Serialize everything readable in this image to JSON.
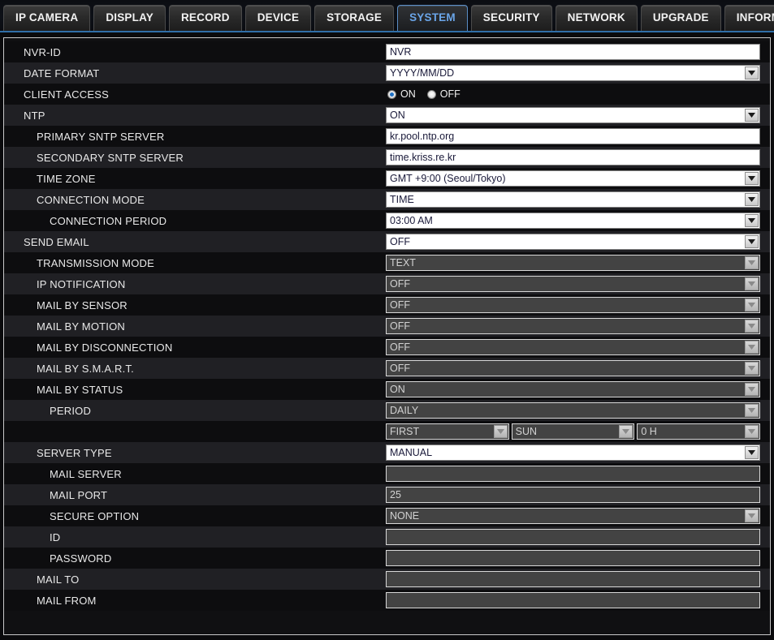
{
  "tabs": [
    {
      "label": "IP CAMERA",
      "active": false
    },
    {
      "label": "DISPLAY",
      "active": false
    },
    {
      "label": "RECORD",
      "active": false
    },
    {
      "label": "DEVICE",
      "active": false
    },
    {
      "label": "STORAGE",
      "active": false
    },
    {
      "label": "SYSTEM",
      "active": true
    },
    {
      "label": "SECURITY",
      "active": false
    },
    {
      "label": "NETWORK",
      "active": false
    },
    {
      "label": "UPGRADE",
      "active": false
    },
    {
      "label": "INFORMATION",
      "active": false
    }
  ],
  "colors": {
    "active_tab_text": "#6aa5e8",
    "tab_underline": "#2f6ea8",
    "radio_selected": "#1d6fc4",
    "input_text": "#1a1a3a",
    "disabled_text": "#d2d2d2",
    "disabled_bg": "#434343"
  },
  "radio": {
    "on_label": "ON",
    "off_label": "OFF",
    "selected": "ON"
  },
  "rows": [
    {
      "label": "NVR-ID",
      "indent": 0,
      "type": "text",
      "value": "NVR",
      "disabled": false
    },
    {
      "label": "DATE FORMAT",
      "indent": 0,
      "type": "select",
      "value": "YYYY/MM/DD",
      "disabled": false
    },
    {
      "label": "CLIENT ACCESS",
      "indent": 0,
      "type": "radio",
      "value": "ON",
      "disabled": false
    },
    {
      "label": "NTP",
      "indent": 0,
      "type": "select",
      "value": "ON",
      "disabled": false
    },
    {
      "label": "PRIMARY SNTP SERVER",
      "indent": 1,
      "type": "text",
      "value": "kr.pool.ntp.org",
      "disabled": false
    },
    {
      "label": "SECONDARY SNTP SERVER",
      "indent": 1,
      "type": "text",
      "value": "time.kriss.re.kr",
      "disabled": false
    },
    {
      "label": "TIME ZONE",
      "indent": 1,
      "type": "select",
      "value": "GMT +9:00 (Seoul/Tokyo)",
      "disabled": false
    },
    {
      "label": "CONNECTION MODE",
      "indent": 1,
      "type": "select",
      "value": "TIME",
      "disabled": false
    },
    {
      "label": "CONNECTION PERIOD",
      "indent": 2,
      "type": "select",
      "value": "03:00 AM",
      "disabled": false
    },
    {
      "label": "SEND EMAIL",
      "indent": 0,
      "type": "select",
      "value": "OFF",
      "disabled": false
    },
    {
      "label": "TRANSMISSION MODE",
      "indent": 1,
      "type": "select",
      "value": "TEXT",
      "disabled": true
    },
    {
      "label": "IP NOTIFICATION",
      "indent": 1,
      "type": "select",
      "value": "OFF",
      "disabled": true
    },
    {
      "label": "MAIL BY SENSOR",
      "indent": 1,
      "type": "select",
      "value": "OFF",
      "disabled": true
    },
    {
      "label": "MAIL BY MOTION",
      "indent": 1,
      "type": "select",
      "value": "OFF",
      "disabled": true
    },
    {
      "label": "MAIL BY DISCONNECTION",
      "indent": 1,
      "type": "select",
      "value": "OFF",
      "disabled": true
    },
    {
      "label": "MAIL BY S.M.A.R.T.",
      "indent": 1,
      "type": "select",
      "value": "OFF",
      "disabled": true
    },
    {
      "label": "MAIL BY STATUS",
      "indent": 1,
      "type": "select",
      "value": "ON",
      "disabled": true
    },
    {
      "label": "PERIOD",
      "indent": 2,
      "type": "select",
      "value": "DAILY",
      "disabled": true
    },
    {
      "label": "",
      "indent": 2,
      "type": "triple",
      "values": [
        "FIRST",
        "SUN",
        "0 H"
      ],
      "disabled": true
    },
    {
      "label": "SERVER TYPE",
      "indent": 1,
      "type": "select",
      "value": "MANUAL",
      "disabled": false
    },
    {
      "label": "MAIL SERVER",
      "indent": 2,
      "type": "text",
      "value": "",
      "disabled": true
    },
    {
      "label": "MAIL PORT",
      "indent": 2,
      "type": "text",
      "value": "25",
      "disabled": true
    },
    {
      "label": "SECURE OPTION",
      "indent": 2,
      "type": "select",
      "value": "NONE",
      "disabled": true
    },
    {
      "label": "ID",
      "indent": 2,
      "type": "text",
      "value": "",
      "disabled": true
    },
    {
      "label": "PASSWORD",
      "indent": 2,
      "type": "text",
      "value": "",
      "disabled": true
    },
    {
      "label": "MAIL TO",
      "indent": 1,
      "type": "text",
      "value": "",
      "disabled": true
    },
    {
      "label": "MAIL FROM",
      "indent": 1,
      "type": "text",
      "value": "",
      "disabled": true
    }
  ]
}
